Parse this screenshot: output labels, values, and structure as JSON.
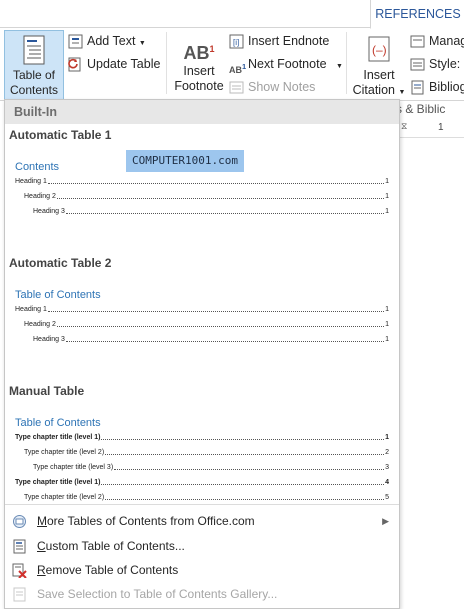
{
  "ribbon": {
    "active_tab": "REFERENCES",
    "toc_button": {
      "line1": "Table of",
      "line2": "Contents"
    },
    "add_text": "Add Text",
    "update_table": "Update Table",
    "insert_footnote": {
      "line1": "Insert",
      "line2": "Footnote"
    },
    "insert_endnote": "Insert Endnote",
    "next_footnote": "Next Footnote",
    "show_notes": "Show Notes",
    "insert_citation": {
      "line1": "Insert",
      "line2": "Citation"
    },
    "manage_sources": "Manag",
    "style_label": "Style:",
    "bibliography": "Bibliog",
    "group_label": "ions & Biblic",
    "ruler_mark": "1"
  },
  "gallery": {
    "section_header": "Built-In",
    "watermark": "COMPUTER1001.com",
    "items": [
      {
        "title": "Automatic Table 1",
        "heading": "Contents",
        "lines": [
          {
            "text": "Heading 1",
            "page": "1"
          },
          {
            "text": "Heading 2",
            "page": "1"
          },
          {
            "text": "Heading 3",
            "page": "1"
          }
        ]
      },
      {
        "title": "Automatic Table 2",
        "heading": "Table of Contents",
        "lines": [
          {
            "text": "Heading 1",
            "page": "1"
          },
          {
            "text": "Heading 2",
            "page": "1"
          },
          {
            "text": "Heading 3",
            "page": "1"
          }
        ]
      },
      {
        "title": "Manual Table",
        "heading": "Table of Contents",
        "lines": [
          {
            "text": "Type chapter title (level 1)",
            "page": "1"
          },
          {
            "text": "Type chapter title (level 2)",
            "page": "2"
          },
          {
            "text": "Type chapter title (level 3)",
            "page": "3"
          },
          {
            "text": "Type chapter title (level 1)",
            "page": "4"
          },
          {
            "text": "Type chapter title (level 2)",
            "page": "5"
          }
        ]
      }
    ]
  },
  "menu": {
    "more_tables": {
      "prefix": "",
      "key": "M",
      "rest": "ore Tables of Contents from Office.com"
    },
    "custom": {
      "prefix": "",
      "key": "C",
      "rest": "ustom Table of Contents..."
    },
    "remove": {
      "prefix": "",
      "key": "R",
      "rest": "emove Table of Contents"
    },
    "save_selection": "Save Selection to Table of Contents Gallery..."
  }
}
